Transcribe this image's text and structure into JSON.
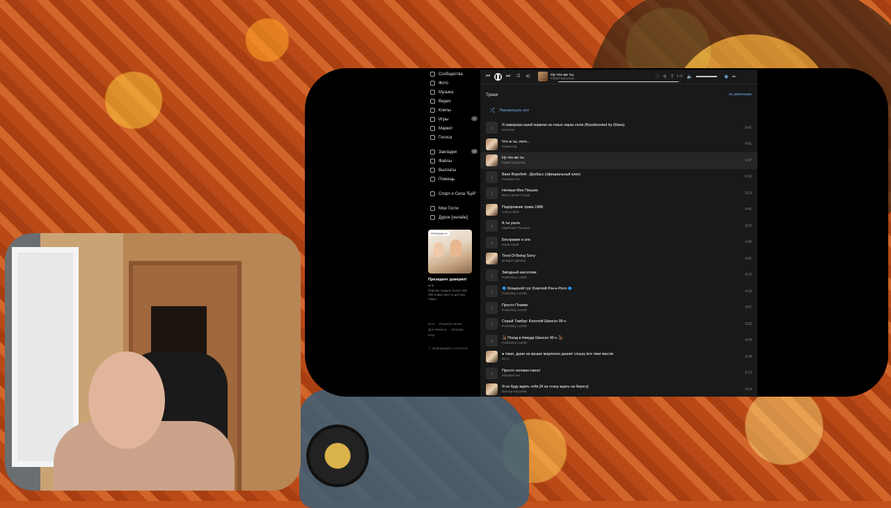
{
  "sidebar": {
    "items": [
      {
        "label": "Сообщества",
        "icon": "people-icon"
      },
      {
        "label": "Фото",
        "icon": "photo-icon"
      },
      {
        "label": "Музыка",
        "icon": "music-icon"
      },
      {
        "label": "Видео",
        "icon": "video-icon"
      },
      {
        "label": "Клипы",
        "icon": "clips-icon"
      },
      {
        "label": "Игры",
        "icon": "games-icon",
        "badge": "2"
      },
      {
        "label": "Маркет",
        "icon": "market-icon"
      },
      {
        "label": "Голоса",
        "icon": "votes-icon"
      }
    ],
    "items2": [
      {
        "label": "Закладки",
        "icon": "bookmark-icon",
        "badge": "24"
      },
      {
        "label": "Файлы",
        "icon": "files-icon"
      },
      {
        "label": "Выплаты",
        "icon": "payments-icon"
      },
      {
        "label": "Помощь",
        "icon": "help-icon"
      }
    ],
    "items3": [
      {
        "label": "Спорт и Сила \"Буй\"",
        "icon": "community-icon"
      }
    ],
    "items4": [
      {
        "label": "Мои Гости",
        "icon": "guests-icon"
      },
      {
        "label": "Дурох [онлайн]",
        "icon": "game-icon"
      }
    ],
    "ad": {
      "tag": "РЕКЛАМА 0+",
      "title": "Президент доверял!",
      "subtitle": "ЕГЕ",
      "desc": "Партия создала более 250 000 новых мест в детских садах"
    },
    "footer": [
      "Блог",
      "Разработчикам",
      "Для бизнеса",
      "Авторам",
      "Ещё"
    ],
    "info": "Информация о контенте"
  },
  "player": {
    "title": "Ну что же ты",
    "artist": "Юрий Шатунов",
    "time": "4:37",
    "progress": 0.98
  },
  "tracks_header": {
    "title": "Треки",
    "sort": "по умолчанию",
    "shuffle": "Перемешать все"
  },
  "tracks": [
    {
      "title": "Я замерзаю,ешей кормлю на голых нарах сплю (Bassboosted by iSlava)",
      "artist": "Блатняк",
      "duration": "5:41",
      "cover": false
    },
    {
      "title": "Что ж ты, лето...",
      "artist": "Комиссар",
      "duration": "4:51",
      "cover": true
    },
    {
      "title": "Ну что же ты",
      "artist": "Юрий Шатунов",
      "duration": "4:37",
      "cover": true,
      "active": true
    },
    {
      "title": "Ваня Воробей - Донбасс (официальный клип)",
      "artist": "Неизвестен",
      "duration": "6:10",
      "cover": false
    },
    {
      "title": "Неляши Мне Письмо",
      "artist": "ВИА Синяя Птица",
      "duration": "3:13",
      "cover": false
    },
    {
      "title": "Подорожник трава 1988",
      "artist": "Алиса Мон",
      "duration": "4:41",
      "cover": true
    },
    {
      "title": "А ты ушла",
      "artist": "Карбонат Рулькин",
      "duration": "3:15",
      "cover": false
    },
    {
      "title": "Бесправие и зло",
      "artist": "Garik Garik",
      "duration": "3:42",
      "cover": false
    },
    {
      "title": "Tired Of Being Sorry",
      "artist": "Enrique Iglesias",
      "duration": "4:01",
      "cover": true
    },
    {
      "title": "Звёздный кассетник",
      "artist": "Posledniy LUDIK",
      "duration": "4:12",
      "cover": false
    },
    {
      "title": "🔷 Козырной туз: Блатной Рок-н-Ролл 🔷",
      "artist": "Posledniy LUDIK",
      "duration": "4:10",
      "cover": false
    },
    {
      "title": "Просто Позиви",
      "artist": "Posledniy LUDIK",
      "duration": "4:07",
      "cover": false
    },
    {
      "title": "Серый Тамбур: Блатной Шансон 90-х",
      "artist": "Posledniy LUDIK",
      "duration": "3:33",
      "cover": false
    },
    {
      "title": "🚂 Поезд в Никуда Шансон 90-х 🚂",
      "artist": "Posledniy LUDIK",
      "duration": "4:24",
      "cover": false
    },
    {
      "title": "● тише, душе на крыше медленно дышит слышу все твои мысли",
      "artist": "Би-2",
      "duration": "3:18",
      "cover": true
    },
    {
      "title": "Просто человек говно!",
      "artist": "Неизвестен",
      "duration": "2:13",
      "cover": false
    },
    {
      "title": "Я не буду ждать тебя [Я не стану ждать на берегу]",
      "artist": "Виктор Королёв",
      "duration": "4:14",
      "cover": true
    }
  ]
}
